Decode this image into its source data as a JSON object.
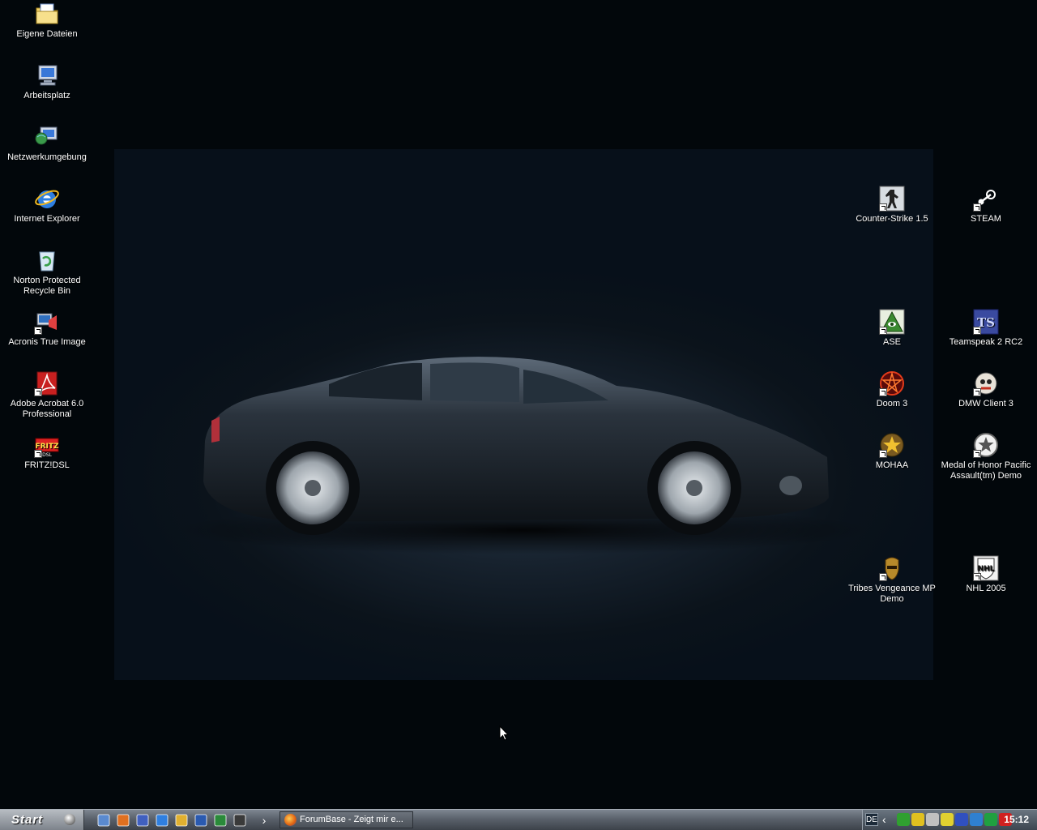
{
  "desktop_icons_left": [
    {
      "label": "Eigene Dateien",
      "icon": "folder-documents-icon",
      "shortcut": false
    },
    {
      "label": "Arbeitsplatz",
      "icon": "my-computer-icon",
      "shortcut": false
    },
    {
      "label": "Netzwerkumgebung",
      "icon": "network-places-icon",
      "shortcut": false
    },
    {
      "label": "Internet Explorer",
      "icon": "internet-explorer-icon",
      "shortcut": false
    },
    {
      "label": "Norton Protected Recycle Bin",
      "icon": "recycle-bin-icon",
      "shortcut": false
    },
    {
      "label": "Acronis True Image",
      "icon": "acronis-icon",
      "shortcut": true
    },
    {
      "label": "Adobe Acrobat 6.0 Professional",
      "icon": "acrobat-icon",
      "shortcut": true
    },
    {
      "label": "FRITZ!DSL",
      "icon": "fritz-dsl-icon",
      "shortcut": true
    }
  ],
  "desktop_icons_right": [
    {
      "label": "Counter-Strike 1.5",
      "icon": "counter-strike-icon",
      "shortcut": true
    },
    {
      "label": "STEAM",
      "icon": "steam-icon",
      "shortcut": true
    },
    {
      "label": "ASE",
      "icon": "ase-icon",
      "shortcut": true
    },
    {
      "label": "Teamspeak 2 RC2",
      "icon": "teamspeak-icon",
      "shortcut": true
    },
    {
      "label": "Doom 3",
      "icon": "doom3-icon",
      "shortcut": true
    },
    {
      "label": "DMW Client 3",
      "icon": "dmw-client-icon",
      "shortcut": true
    },
    {
      "label": "MOHAA",
      "icon": "mohaa-icon",
      "shortcut": true
    },
    {
      "label": "Medal of Honor Pacific Assault(tm) Demo",
      "icon": "moh-pacific-icon",
      "shortcut": true
    },
    {
      "label": "Tribes Vengeance MP Demo",
      "icon": "tribes-icon",
      "shortcut": true
    },
    {
      "label": "NHL 2005",
      "icon": "nhl2005-icon",
      "shortcut": true
    }
  ],
  "taskbar": {
    "start_label": "Start",
    "quicklaunch": [
      "show-desktop-icon",
      "firefox-icon",
      "media-icon",
      "internet-explorer-icon",
      "outlook-icon",
      "word-icon",
      "excel-icon",
      "winamp-icon"
    ],
    "quicklaunch_more": "›",
    "task_button_label": "ForumBase - Zeigt mir e...",
    "language": "DE",
    "tray_chevron": "‹",
    "tray_icons": [
      "network-icon",
      "norton-icon",
      "volume-icon",
      "antivirus-icon",
      "monitor-icon",
      "globe-icon",
      "connection-icon",
      "ati-icon"
    ],
    "clock": "15:12"
  },
  "colors": {
    "desktop_bg": "#02070b",
    "wallpaper_center": "#2b3d4e",
    "taskbar_top": "#7e8691",
    "taskbar_bottom": "#3c424a"
  }
}
